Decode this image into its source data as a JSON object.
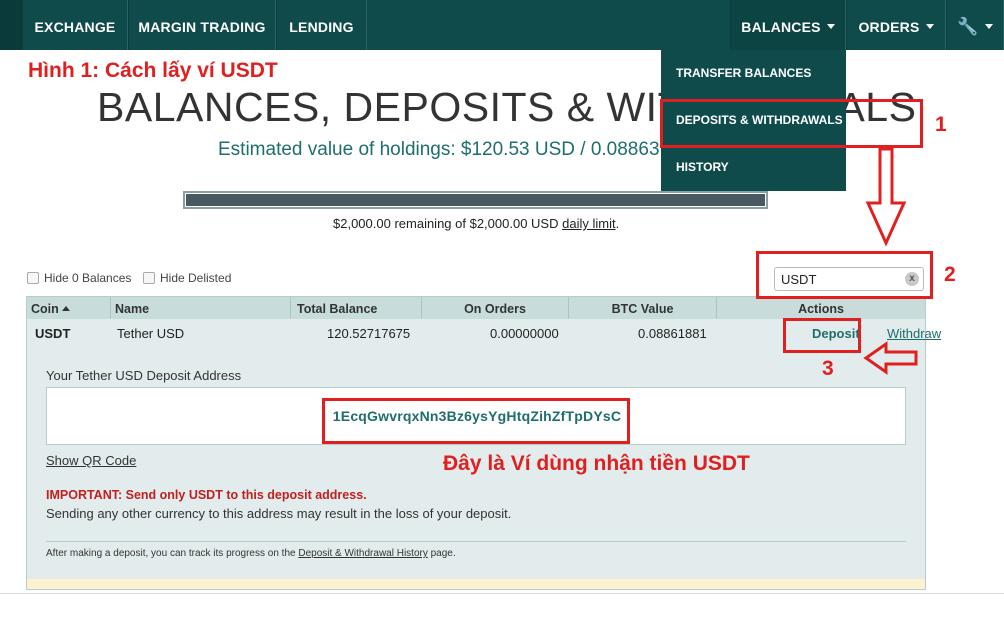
{
  "nav": {
    "items": [
      {
        "label": "EXCHANGE"
      },
      {
        "label": "MARGIN TRADING"
      },
      {
        "label": "LENDING"
      }
    ],
    "balances_label": "BALANCES",
    "orders_label": "ORDERS",
    "tools_icon": "wrench-icon"
  },
  "dropdown": {
    "items": [
      {
        "label": "TRANSFER BALANCES"
      },
      {
        "label": "DEPOSITS & WITHDRAWALS"
      },
      {
        "label": "HISTORY"
      }
    ]
  },
  "annotation": {
    "title": "Hình 1: Cách lấy ví USDT",
    "step1": "1",
    "step2": "2",
    "step3": "3",
    "caption": "Đây là Ví dùng nhận tiền USDT",
    "color": "#e02020"
  },
  "page": {
    "title": "BALANCES, DEPOSITS & WITHDRAWALS",
    "estimated_value": "Estimated value of holdings: $120.53 USD / 0.08863 BTC",
    "limit_prefix": "$2,000.00 remaining of $2,000.00 USD ",
    "limit_link": "daily limit",
    "limit_suffix": ".",
    "limit_fill_fraction": 1.0
  },
  "filters": {
    "hide_zero": "Hide 0 Balances",
    "hide_delisted": "Hide Delisted"
  },
  "search": {
    "value": "USDT",
    "clear_label": "x"
  },
  "table": {
    "headers": {
      "coin": "Coin",
      "name": "Name",
      "total": "Total Balance",
      "orders": "On Orders",
      "btc": "BTC Value",
      "actions": "Actions"
    },
    "row": {
      "coin": "USDT",
      "name": "Tether USD",
      "total": "120.52717675",
      "orders": "0.00000000",
      "btc": "0.08861881",
      "deposit": "Deposit",
      "withdraw": "Withdraw"
    }
  },
  "deposit": {
    "label": "Your Tether USD Deposit Address",
    "address": "1EcqGwvrqxNn3Bz6ysYgHtqZihZfTpDYsC",
    "qr_link": "Show QR Code",
    "important": "IMPORTANT: Send only USDT to this deposit address.",
    "warning": "Sending any other currency to this address may result in the loss of your deposit.",
    "note_prefix": "After making a deposit, you can track its progress on the ",
    "note_link": "Deposit & Withdrawal History",
    "note_suffix": " page."
  },
  "colors": {
    "nav_bg": "#0f4b4b",
    "accent_teal": "#1f6d6d",
    "annotation_red": "#e02020"
  }
}
